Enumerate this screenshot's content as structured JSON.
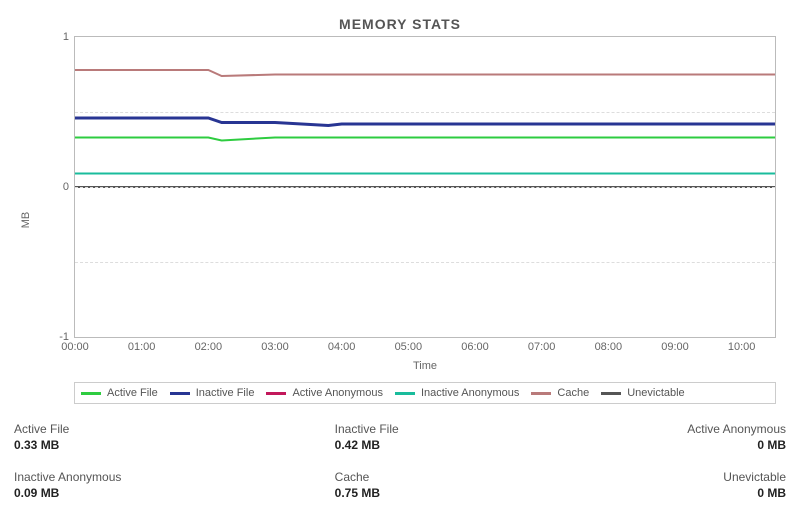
{
  "title": "MEMORY STATS",
  "ylabel": "MB",
  "xlabel": "Time",
  "legend": {
    "active_file": "Active File",
    "inactive_file": "Inactive File",
    "active_anon": "Active Anonymous",
    "inactive_anon": "Inactive Anonymous",
    "cache": "Cache",
    "unevictable": "Unevictable"
  },
  "stats": {
    "active_file": {
      "label": "Active File",
      "value": "0.33 MB"
    },
    "inactive_file": {
      "label": "Inactive File",
      "value": "0.42 MB"
    },
    "active_anon": {
      "label": "Active Anonymous",
      "value": "0 MB"
    },
    "inactive_anon": {
      "label": "Inactive Anonymous",
      "value": "0.09 MB"
    },
    "cache": {
      "label": "Cache",
      "value": "0.75 MB"
    },
    "unevictable": {
      "label": "Unevictable",
      "value": "0 MB"
    }
  },
  "colors": {
    "active_file": "#2ecc40",
    "inactive_file": "#283593",
    "active_anon": "#c2185b",
    "inactive_anon": "#1abc9c",
    "cache": "#b97a7a",
    "unevictable": "#555555"
  },
  "chart_data": {
    "type": "line",
    "xlabel": "Time",
    "ylabel": "MB",
    "ylim": [
      -1,
      1
    ],
    "x_ticks": [
      "00:00",
      "01:00",
      "02:00",
      "03:00",
      "04:00",
      "05:00",
      "06:00",
      "07:00",
      "08:00",
      "09:00",
      "10:00"
    ],
    "y_ticks": [
      -1,
      0,
      1
    ],
    "x": [
      0,
      1,
      2,
      2.2,
      3,
      3.8,
      4,
      5,
      6,
      7,
      8,
      9,
      10,
      10.5
    ],
    "series": [
      {
        "name": "Active File",
        "key": "active_file",
        "values": [
          0.33,
          0.33,
          0.33,
          0.31,
          0.33,
          0.33,
          0.33,
          0.33,
          0.33,
          0.33,
          0.33,
          0.33,
          0.33,
          0.33
        ]
      },
      {
        "name": "Inactive File",
        "key": "inactive_file",
        "values": [
          0.46,
          0.46,
          0.46,
          0.43,
          0.43,
          0.41,
          0.42,
          0.42,
          0.42,
          0.42,
          0.42,
          0.42,
          0.42,
          0.42
        ]
      },
      {
        "name": "Active Anonymous",
        "key": "active_anon",
        "values": [
          0,
          0,
          0,
          0,
          0,
          0,
          0,
          0,
          0,
          0,
          0,
          0,
          0,
          0
        ]
      },
      {
        "name": "Inactive Anonymous",
        "key": "inactive_anon",
        "values": [
          0.09,
          0.09,
          0.09,
          0.09,
          0.09,
          0.09,
          0.09,
          0.09,
          0.09,
          0.09,
          0.09,
          0.09,
          0.09,
          0.09
        ]
      },
      {
        "name": "Cache",
        "key": "cache",
        "values": [
          0.78,
          0.78,
          0.78,
          0.74,
          0.75,
          0.75,
          0.75,
          0.75,
          0.75,
          0.75,
          0.75,
          0.75,
          0.75,
          0.75
        ]
      },
      {
        "name": "Unevictable",
        "key": "unevictable",
        "values": [
          0,
          0,
          0,
          0,
          0,
          0,
          0,
          0,
          0,
          0,
          0,
          0,
          0,
          0
        ]
      }
    ],
    "xlim": [
      0,
      10.5
    ]
  }
}
